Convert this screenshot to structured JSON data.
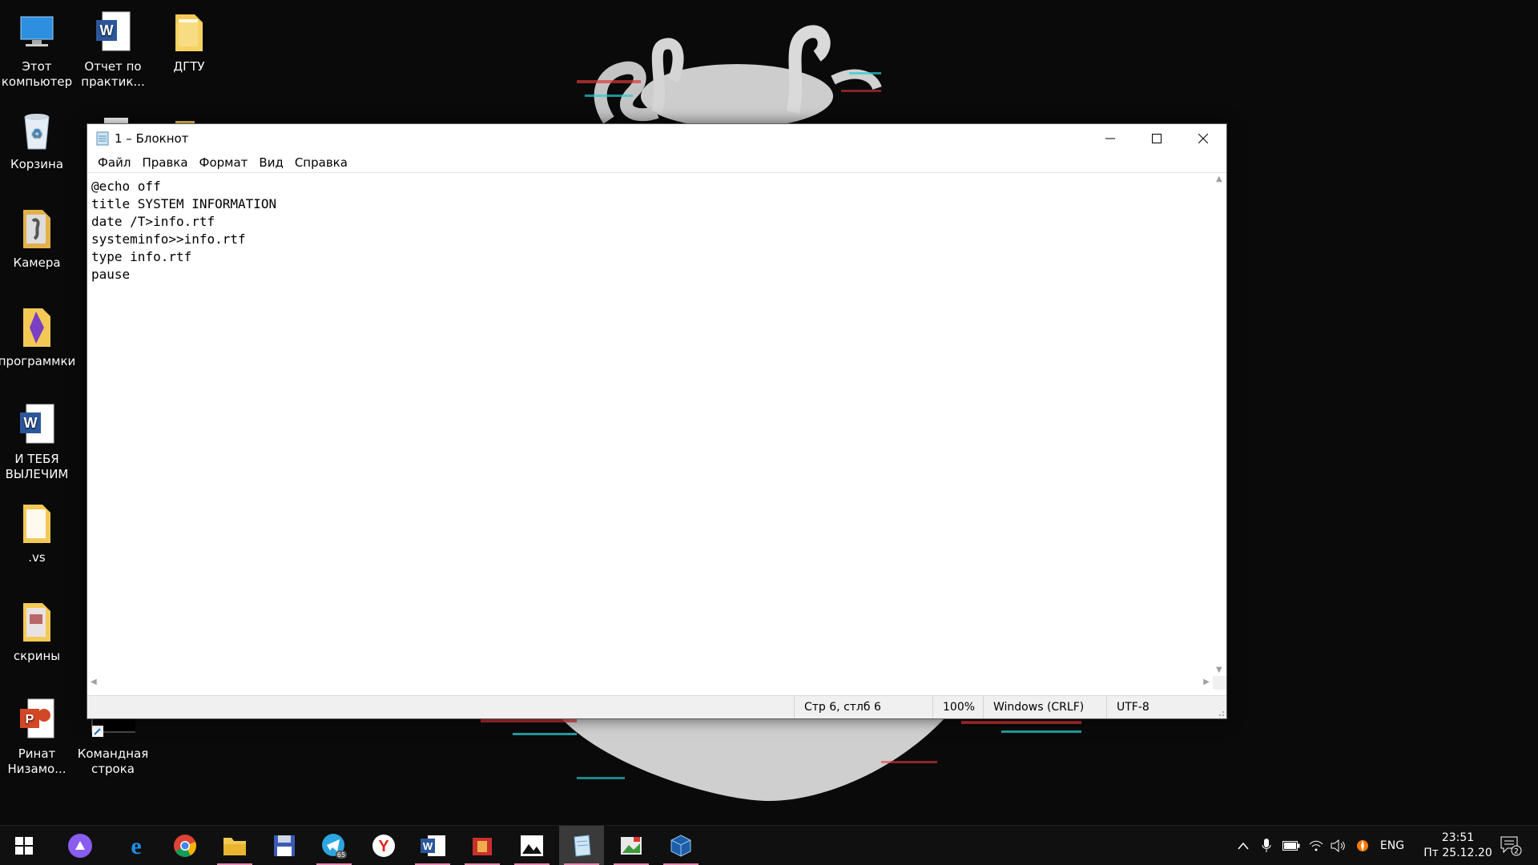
{
  "desktop": {
    "icons": [
      {
        "label": "Этот\nкомпьютер"
      },
      {
        "label": "Отчет по\nпрактик..."
      },
      {
        "label": "ДГТУ"
      },
      {
        "label": "Корзина"
      },
      {
        "label": "Камера"
      },
      {
        "label": "программки"
      },
      {
        "label": "И ТЕБЯ\nВЫЛЕЧИМ"
      },
      {
        "label": ".vs"
      },
      {
        "label": "скрины"
      },
      {
        "label": "Ринат\nНизамо..."
      },
      {
        "label": "Командная\nстрока"
      }
    ]
  },
  "notepad": {
    "title": "1 – Блокнот",
    "menu": [
      "Файл",
      "Правка",
      "Формат",
      "Вид",
      "Справка"
    ],
    "content": "@echo off\ntitle SYSTEM INFORMATION\ndate /T>info.rtf\nsysteminfo>>info.rtf\ntype info.rtf\npause",
    "status": {
      "position": "Стр 6, стлб 6",
      "zoom": "100%",
      "line_ending": "Windows (CRLF)",
      "encoding": "UTF-8"
    }
  },
  "taskbar": {
    "apps": [
      "start",
      "cortana",
      "edge",
      "chrome",
      "file-explorer",
      "save",
      "telegram",
      "yandex-browser",
      "word",
      "red-app",
      "photos",
      "notepad",
      "image-editor",
      "virtualbox"
    ],
    "telegram_badge": "65",
    "tray": {
      "language": "ENG",
      "time": "23:51",
      "date": "Пт 25.12.20",
      "notifications_count": "2"
    }
  }
}
